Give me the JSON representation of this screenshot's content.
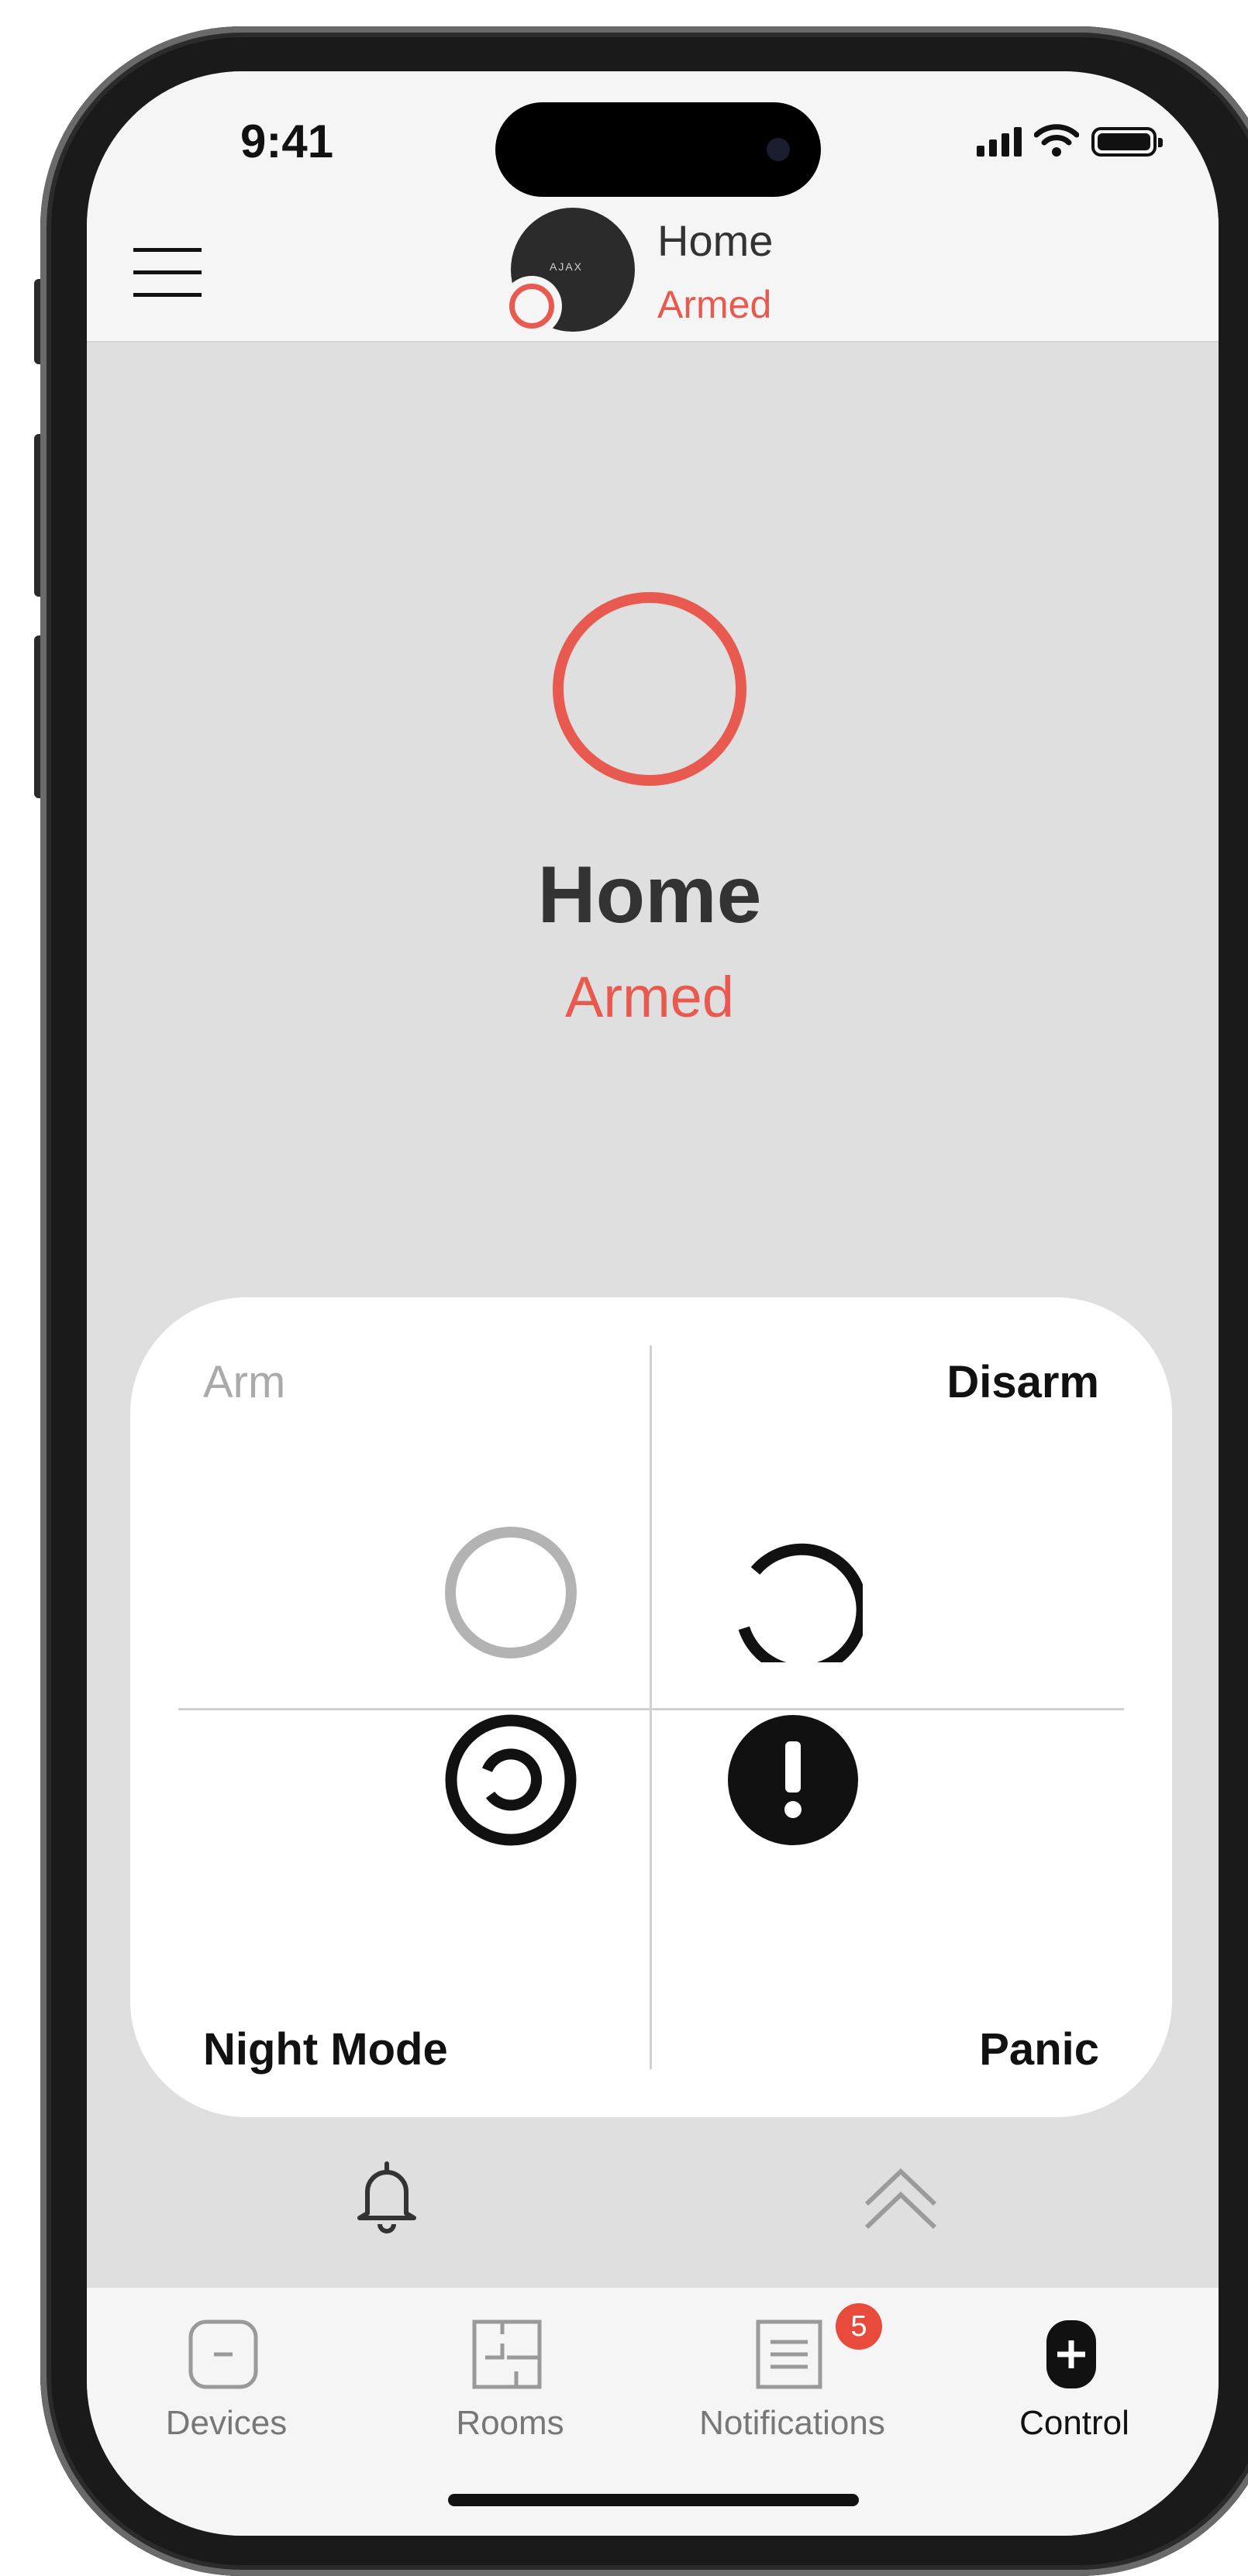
{
  "status_bar": {
    "time": "9:41"
  },
  "header": {
    "hub_name": "Home",
    "hub_status": "Armed",
    "hub_logo_text": "AJAX"
  },
  "hero": {
    "name": "Home",
    "status": "Armed"
  },
  "controls": {
    "arm_label": "Arm",
    "disarm_label": "Disarm",
    "night_mode_label": "Night Mode",
    "panic_label": "Panic"
  },
  "tabs": [
    {
      "label": "Devices",
      "icon": "devices-icon"
    },
    {
      "label": "Rooms",
      "icon": "rooms-icon"
    },
    {
      "label": "Notifications",
      "icon": "notifications-icon",
      "badge": "5"
    },
    {
      "label": "Control",
      "icon": "control-icon",
      "active": true
    }
  ],
  "colors": {
    "armed_red": "#e85a4f",
    "badge_red": "#e84b3c",
    "background": "#dfdfdf",
    "panel": "#ffffff",
    "text": "#333333"
  }
}
